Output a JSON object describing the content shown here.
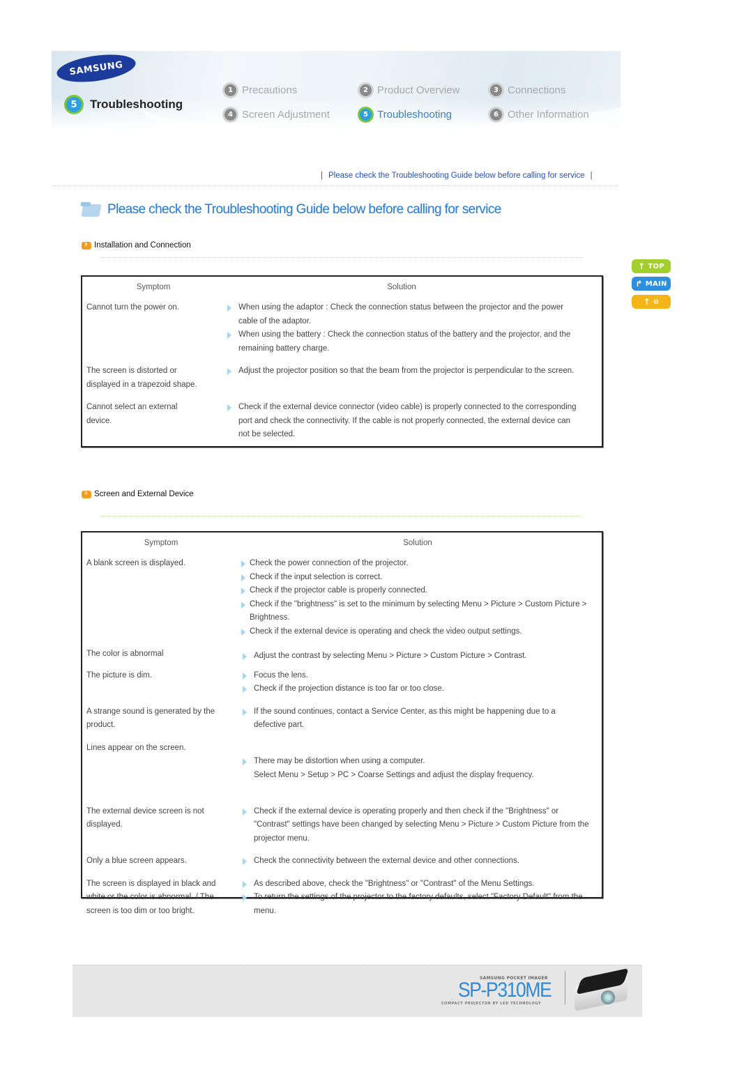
{
  "header": {
    "brand": "SAMSUNG",
    "section_number": "5",
    "section_title": "Troubleshooting",
    "nav": [
      {
        "number": "1",
        "label": "Precautions",
        "current": false
      },
      {
        "number": "2",
        "label": "Product Overview",
        "current": false
      },
      {
        "number": "3",
        "label": "Connections",
        "current": false
      },
      {
        "number": "4",
        "label": "Screen Adjustment",
        "current": false
      },
      {
        "number": "5",
        "label": "Troubleshooting",
        "current": true
      },
      {
        "number": "6",
        "label": "Other Information",
        "current": false
      }
    ]
  },
  "link_line": {
    "separator": "|",
    "text": "Please check the Troubleshooting Guide below before calling for service"
  },
  "page_heading": "Please check the Troubleshooting Guide below before calling for service",
  "side_buttons": {
    "top": "TOP",
    "main": "MAIN",
    "back": "⊖"
  },
  "colors": {
    "link": "#2150c8",
    "heading": "#2f7fd0",
    "top_button": "#a2cf2c",
    "main_button": "#2e8fde",
    "back_button": "#f4b518",
    "section_icon": "#f39c1e"
  },
  "sections": [
    {
      "title": "Installation and Connection",
      "columns": {
        "symptom": "Symptom",
        "solution": "Solution"
      },
      "rows": [
        {
          "symptom": "Cannot turn the power on.",
          "solutions": [
            "When using the adaptor : Check the connection status between the projector and the power cable of the adaptor.",
            "When using the battery : Check the connection status of the battery and the projector, and the remaining battery charge."
          ]
        },
        {
          "symptom": "The screen is distorted or displayed in a trapezoid shape.",
          "solutions": [
            "Adjust the projector position so that the beam from the projector is perpendicular to the screen."
          ]
        },
        {
          "symptom": "Cannot select an external device.",
          "solutions": [
            "Check if the external device connector (video cable) is properly connected to the corresponding port and check the connectivity. If the cable is not properly connected, the external device can not be selected."
          ]
        }
      ]
    },
    {
      "title": "Screen and External Device",
      "columns": {
        "symptom": "Symptom",
        "solution": "Solution"
      },
      "rows": [
        {
          "symptom": "A blank screen is displayed.",
          "solutions": [
            "Check the power connection of the projector.",
            "Check if the input selection is correct.",
            "Check if the projector cable is properly connected.",
            "Check if the \"brightness\" is set to the minimum by selecting Menu > Picture > Custom Picture > Brightness.",
            "Check if the external device is operating and check the video output settings."
          ]
        },
        {
          "symptom": "The color is abnormal",
          "solutions": [
            "Adjust the contrast by selecting Menu > Picture > Custom Picture > Contrast."
          ]
        },
        {
          "symptom": "The picture is dim.",
          "solutions": [
            "Focus the lens.",
            "Check if the projection distance is too far or too close."
          ]
        },
        {
          "symptom": "A strange sound is generated by the product.",
          "solutions": [
            "If the sound continues, contact a Service Center, as this might be happening due to a defective part."
          ]
        },
        {
          "symptom": "Lines appear on the screen.",
          "solutions": [
            "There may be distortion when using a computer.\nSelect Menu > Setup > PC > Coarse Settings and adjust the display frequency."
          ]
        },
        {
          "symptom": "The external device screen is not displayed.",
          "solutions": [
            "Check if the external device is operating properly and then check if the \"Brightness\" or \"Contrast\" settings have been changed by selecting Menu > Picture > Custom Picture from the projector menu."
          ]
        },
        {
          "symptom": "Only a blue screen appears.",
          "solutions": [
            "Check the connectivity between the external device and other connections."
          ]
        },
        {
          "symptom": "The screen is displayed in black and white or the color is abnormal. / The screen is too dim or too bright.",
          "solutions": [
            "As described above, check the \"Brightness\" or \"Contrast\" of the Menu Settings.",
            "To return the settings of the projector to the factory defaults, select \"Factory Default\" from the menu."
          ]
        }
      ]
    }
  ],
  "footer": {
    "tagline_top": "SAMSUNG POCKET IMAGER",
    "model": "SP-P310ME",
    "tagline_bottom": "COMPACT PROJECTOR BY LED TECHNOLOGY"
  }
}
